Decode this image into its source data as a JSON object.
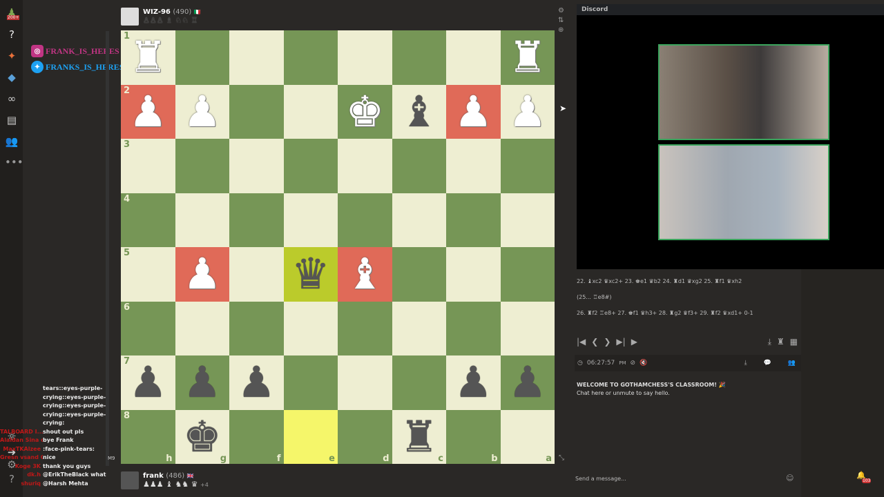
{
  "sidebar": {
    "items": [
      {
        "icon": "pawn-icon",
        "badge": "200+"
      },
      {
        "icon": "puzzle-icon"
      },
      {
        "icon": "lesson-icon"
      },
      {
        "icon": "learn-icon"
      },
      {
        "icon": "watch-icon"
      },
      {
        "icon": "news-icon"
      },
      {
        "icon": "friends-icon",
        "badge": "50"
      },
      {
        "icon": "more-icon"
      },
      {
        "icon": "brightness-icon"
      },
      {
        "icon": "collapse-icon"
      },
      {
        "icon": "settings-icon"
      },
      {
        "icon": "help-icon"
      }
    ]
  },
  "socials": [
    {
      "icon": "instagram-icon",
      "label": "FRANK_IS_HERES",
      "color": "#c13584"
    },
    {
      "icon": "twitter-icon",
      "label": "FRANKS_IS_HERES",
      "color": "#1da1f2"
    }
  ],
  "chat_log": [
    {
      "user": "",
      "msg": "tears::eyes-purple-"
    },
    {
      "user": "",
      "msg": "crying::eyes-purple-"
    },
    {
      "user": "",
      "msg": "crying::eyes-purple-"
    },
    {
      "user": "",
      "msg": "crying::eyes-purple-"
    },
    {
      "user": "",
      "msg": "crying:"
    },
    {
      "user": "TALBOARD I...",
      "msg": "shout out pls"
    },
    {
      "user": "Alaldan Sina ole...",
      "msg": "bye Frank"
    },
    {
      "user": "MaxTKAlzee",
      "msg": ":face-pink-tears:"
    },
    {
      "user": "Gresn vsand G...",
      "msg": "nice"
    },
    {
      "user": "Koge 3K",
      "msg": "thank you guys"
    },
    {
      "user": "dk.h",
      "msg": "@ErikTheBlack what"
    },
    {
      "user": "shuriq",
      "msg": "@Harsh Mehta"
    }
  ],
  "chat_badge": "M9",
  "top_player": {
    "name": "WIZ-96",
    "rating": "(490)",
    "flag": "Italy",
    "captured": "♙♙♙ ♗ ♘♘ ♖"
  },
  "bottom_player": {
    "name": "frank",
    "rating": "(486)",
    "flag": "UK",
    "captured": "♟♟♟ ♝ ♞♞ ♛",
    "advantage": "+4"
  },
  "board": {
    "orientation": "black",
    "ranks": [
      "1",
      "2",
      "3",
      "4",
      "5",
      "6",
      "7",
      "8"
    ],
    "files": [
      "h",
      "g",
      "f",
      "e",
      "d",
      "c",
      "b",
      "a"
    ],
    "colors": {
      "light": "#eeeed2",
      "dark": "#769656",
      "last_move": "#f5f66a",
      "check": "#e06a58",
      "selected": "#bbcb2b"
    },
    "squares": [
      [
        "♜w",
        "",
        "",
        "",
        "",
        "",
        "",
        "♜w"
      ],
      [
        "♟w|red",
        "♟w",
        "",
        "",
        "♚w",
        "♝b",
        "♟w|red",
        "♟w"
      ],
      [
        "",
        "",
        "",
        "",
        "",
        "",
        "",
        ""
      ],
      [
        "",
        "",
        "",
        "",
        "",
        "",
        "",
        ""
      ],
      [
        "",
        "♟w|red",
        "",
        "♛b|lime",
        "♝w|red",
        "",
        "",
        ""
      ],
      [
        "",
        "",
        "",
        "",
        "",
        "",
        "",
        ""
      ],
      [
        "♟b",
        "♟b",
        "♟b",
        "",
        "",
        "",
        "♟b",
        "♟b"
      ],
      [
        "",
        "♚b",
        "",
        "|yel",
        "",
        "♜b",
        "",
        ""
      ]
    ]
  },
  "discord": {
    "title": "Discord"
  },
  "moves": [
    "22. ♝xc2 ♛xc2+ 23. ♚e1 ♛b2 24. ♜d1 ♛xg2 25. ♜f1 ♛xh2",
    "(25... ♖e8#)",
    "26. ♜f2 ♖e8+ 27. ♚f1 ♛h3+ 28. ♜g2 ♛f3+ 29. ♜f2 ♛xd1+ 0-1"
  ],
  "nav": {
    "buttons": [
      "first-icon",
      "prev-icon",
      "next-icon",
      "last-icon",
      "play-icon"
    ],
    "glyphs": [
      "|◀",
      "❮",
      "❯",
      "▶|",
      "▶"
    ]
  },
  "status": {
    "time": "06:27:57",
    "ampm": "PM"
  },
  "welcome": {
    "title": "WELCOME TO GOTHAMCHESS'S CLASSROOM! 🎉",
    "subtitle": "Chat here or unmute to say hello."
  },
  "send": {
    "placeholder": "Send a message..."
  },
  "notif_count": "103"
}
